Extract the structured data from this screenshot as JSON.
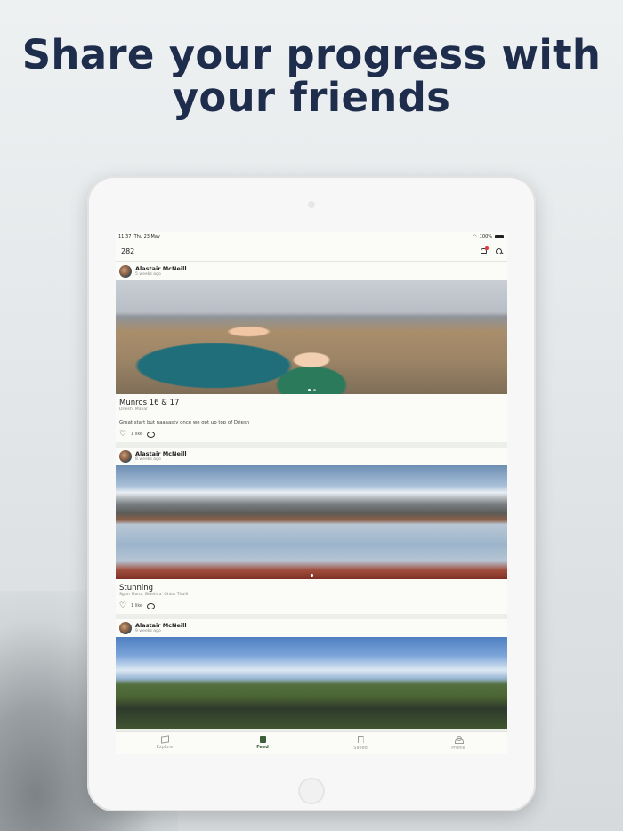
{
  "headline": {
    "line1_bold": "Share",
    "line1_rest": " your progress with",
    "line2_rest": "your ",
    "line2_bold": "friends"
  },
  "status_bar": {
    "time": "11:37",
    "date": "Thu 23 May",
    "battery": "100%"
  },
  "app_bar": {
    "count": "282",
    "notification_icon": "bell-icon",
    "search_icon": "search-icon"
  },
  "posts": [
    {
      "author": "Alastair McNeill",
      "time": "5 weeks ago",
      "title": "Munros 16 & 17",
      "location": "Driesh, Mayar",
      "text": "Great start but naaaasty once we got up top of Driesh",
      "likes": "1 like"
    },
    {
      "author": "Alastair McNeill",
      "time": "8 weeks ago",
      "title": "Stunning",
      "location": "Sgurr Fiona, Bidein a' Ghlas Thuill",
      "text": "",
      "likes": "1 like"
    },
    {
      "author": "Alastair McNeill",
      "time": "9 weeks ago"
    }
  ],
  "tabs": [
    {
      "label": "Explore",
      "icon": "map-icon"
    },
    {
      "label": "Feed",
      "icon": "feed-icon"
    },
    {
      "label": "Saved",
      "icon": "bookmark-icon"
    },
    {
      "label": "Profile",
      "icon": "person-icon"
    }
  ],
  "colors": {
    "headline": "#1f2d4d",
    "accent": "#3e5e3a",
    "notification": "#e23b3b"
  }
}
